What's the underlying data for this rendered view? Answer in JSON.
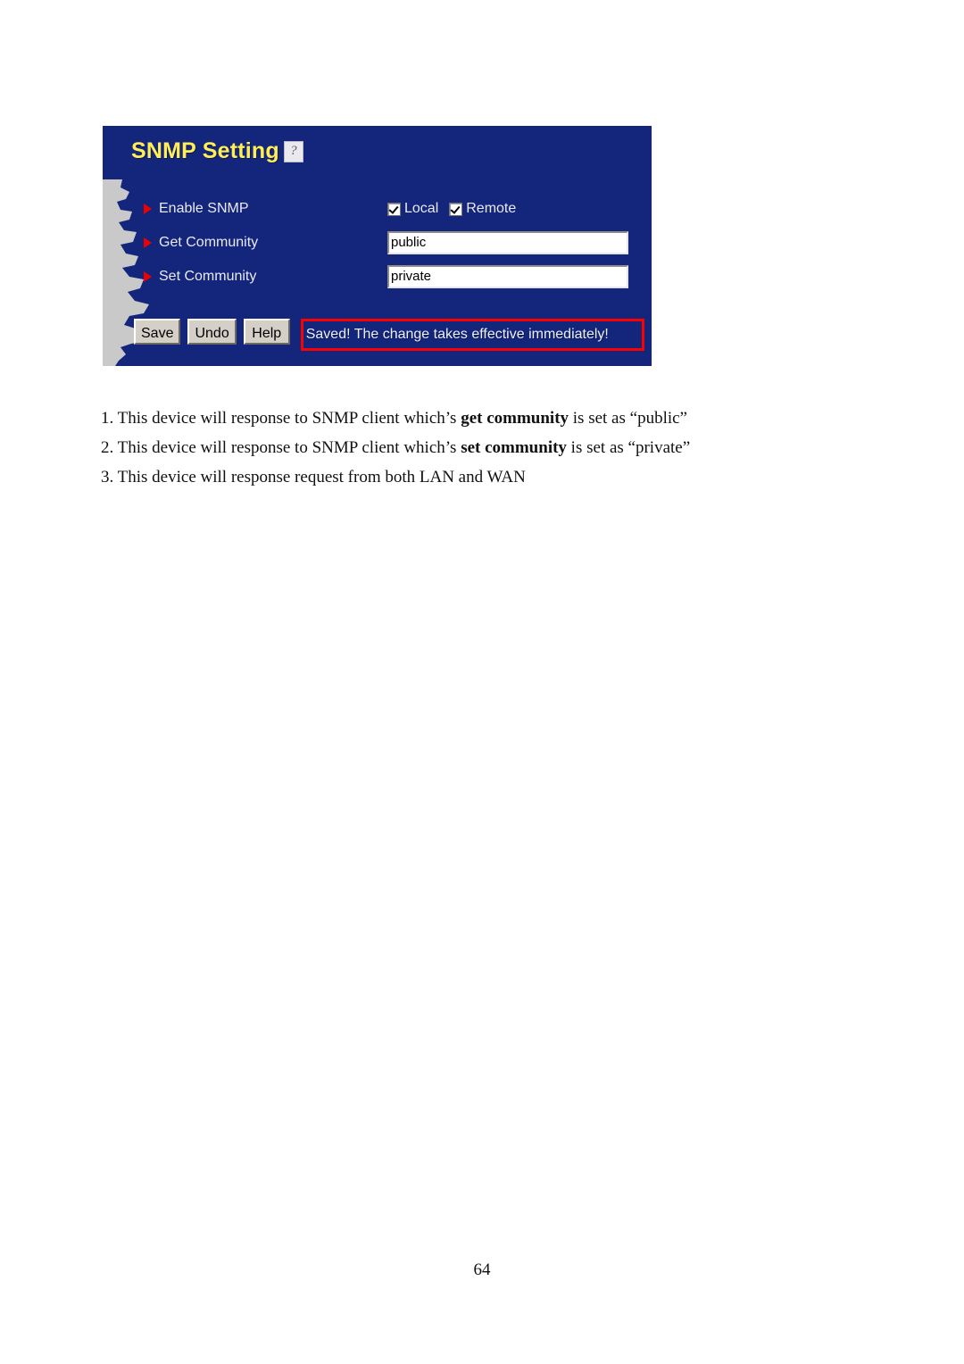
{
  "document": {
    "page_number": "64",
    "notes": [
      {
        "prefix": "1. This device will response to SNMP client which’s ",
        "bold": "get community",
        "suffix": " is set as “public”"
      },
      {
        "prefix": "2. This device will response to SNMP client which’s ",
        "bold": "set community",
        "suffix": " is set as “private”"
      },
      {
        "prefix": "3. This device will response request from both LAN and WAN",
        "bold": "",
        "suffix": ""
      }
    ]
  },
  "panel": {
    "title": "SNMP Setting",
    "help_icon": "question-mark-icon",
    "help_glyph": "?",
    "colors": {
      "background": "#14257c",
      "title": "#ffee55",
      "bullet": "#ee0000",
      "status_border": "#ff0000",
      "button_face": "#d4d0c8"
    },
    "rows": [
      {
        "label": "Enable SNMP",
        "type": "checkbox-group",
        "options": [
          {
            "label": "Local",
            "checked": true
          },
          {
            "label": "Remote",
            "checked": true
          }
        ]
      },
      {
        "label": "Get Community",
        "type": "text",
        "value": "public"
      },
      {
        "label": "Set Community",
        "type": "text",
        "value": "private"
      }
    ],
    "buttons": [
      {
        "label": "Save"
      },
      {
        "label": "Undo"
      },
      {
        "label": "Help"
      }
    ],
    "status_message": "Saved! The change takes effective immediately!"
  }
}
